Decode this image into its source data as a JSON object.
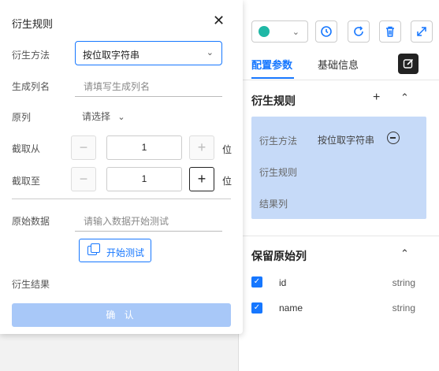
{
  "modal": {
    "title": "衍生规则",
    "fields": {
      "method_label": "衍生方法",
      "method_value": "按位取字符串",
      "colname_label": "生成列名",
      "colname_placeholder": "请填写生成列名",
      "source_label": "原列",
      "source_value": "请选择",
      "from_label": "截取从",
      "from_value": "1",
      "to_label": "截取至",
      "to_value": "1",
      "unit": "位",
      "rawdata_label": "原始数据",
      "rawdata_placeholder": "请输入数据开始测试",
      "test_button": "开始测试",
      "result_label": "衍生结果"
    },
    "confirm_button": "确 认"
  },
  "right_panel": {
    "tabs": [
      "配置参数",
      "基础信息"
    ],
    "active_tab": "配置参数",
    "rule_section": {
      "title": "衍生规则",
      "card": {
        "method_label": "衍生方法",
        "method_value": "按位取字符串",
        "rule_label": "衍生规则",
        "result_label": "结果列"
      }
    },
    "keep_section": {
      "title": "保留原始列",
      "rows": [
        {
          "name": "id",
          "type": "string",
          "checked": true
        },
        {
          "name": "name",
          "type": "string",
          "checked": true
        }
      ]
    }
  },
  "icons": {
    "toolbar": [
      "history-icon",
      "refresh-icon",
      "trash-icon",
      "expand-icon"
    ],
    "accent": "#1677ff"
  }
}
